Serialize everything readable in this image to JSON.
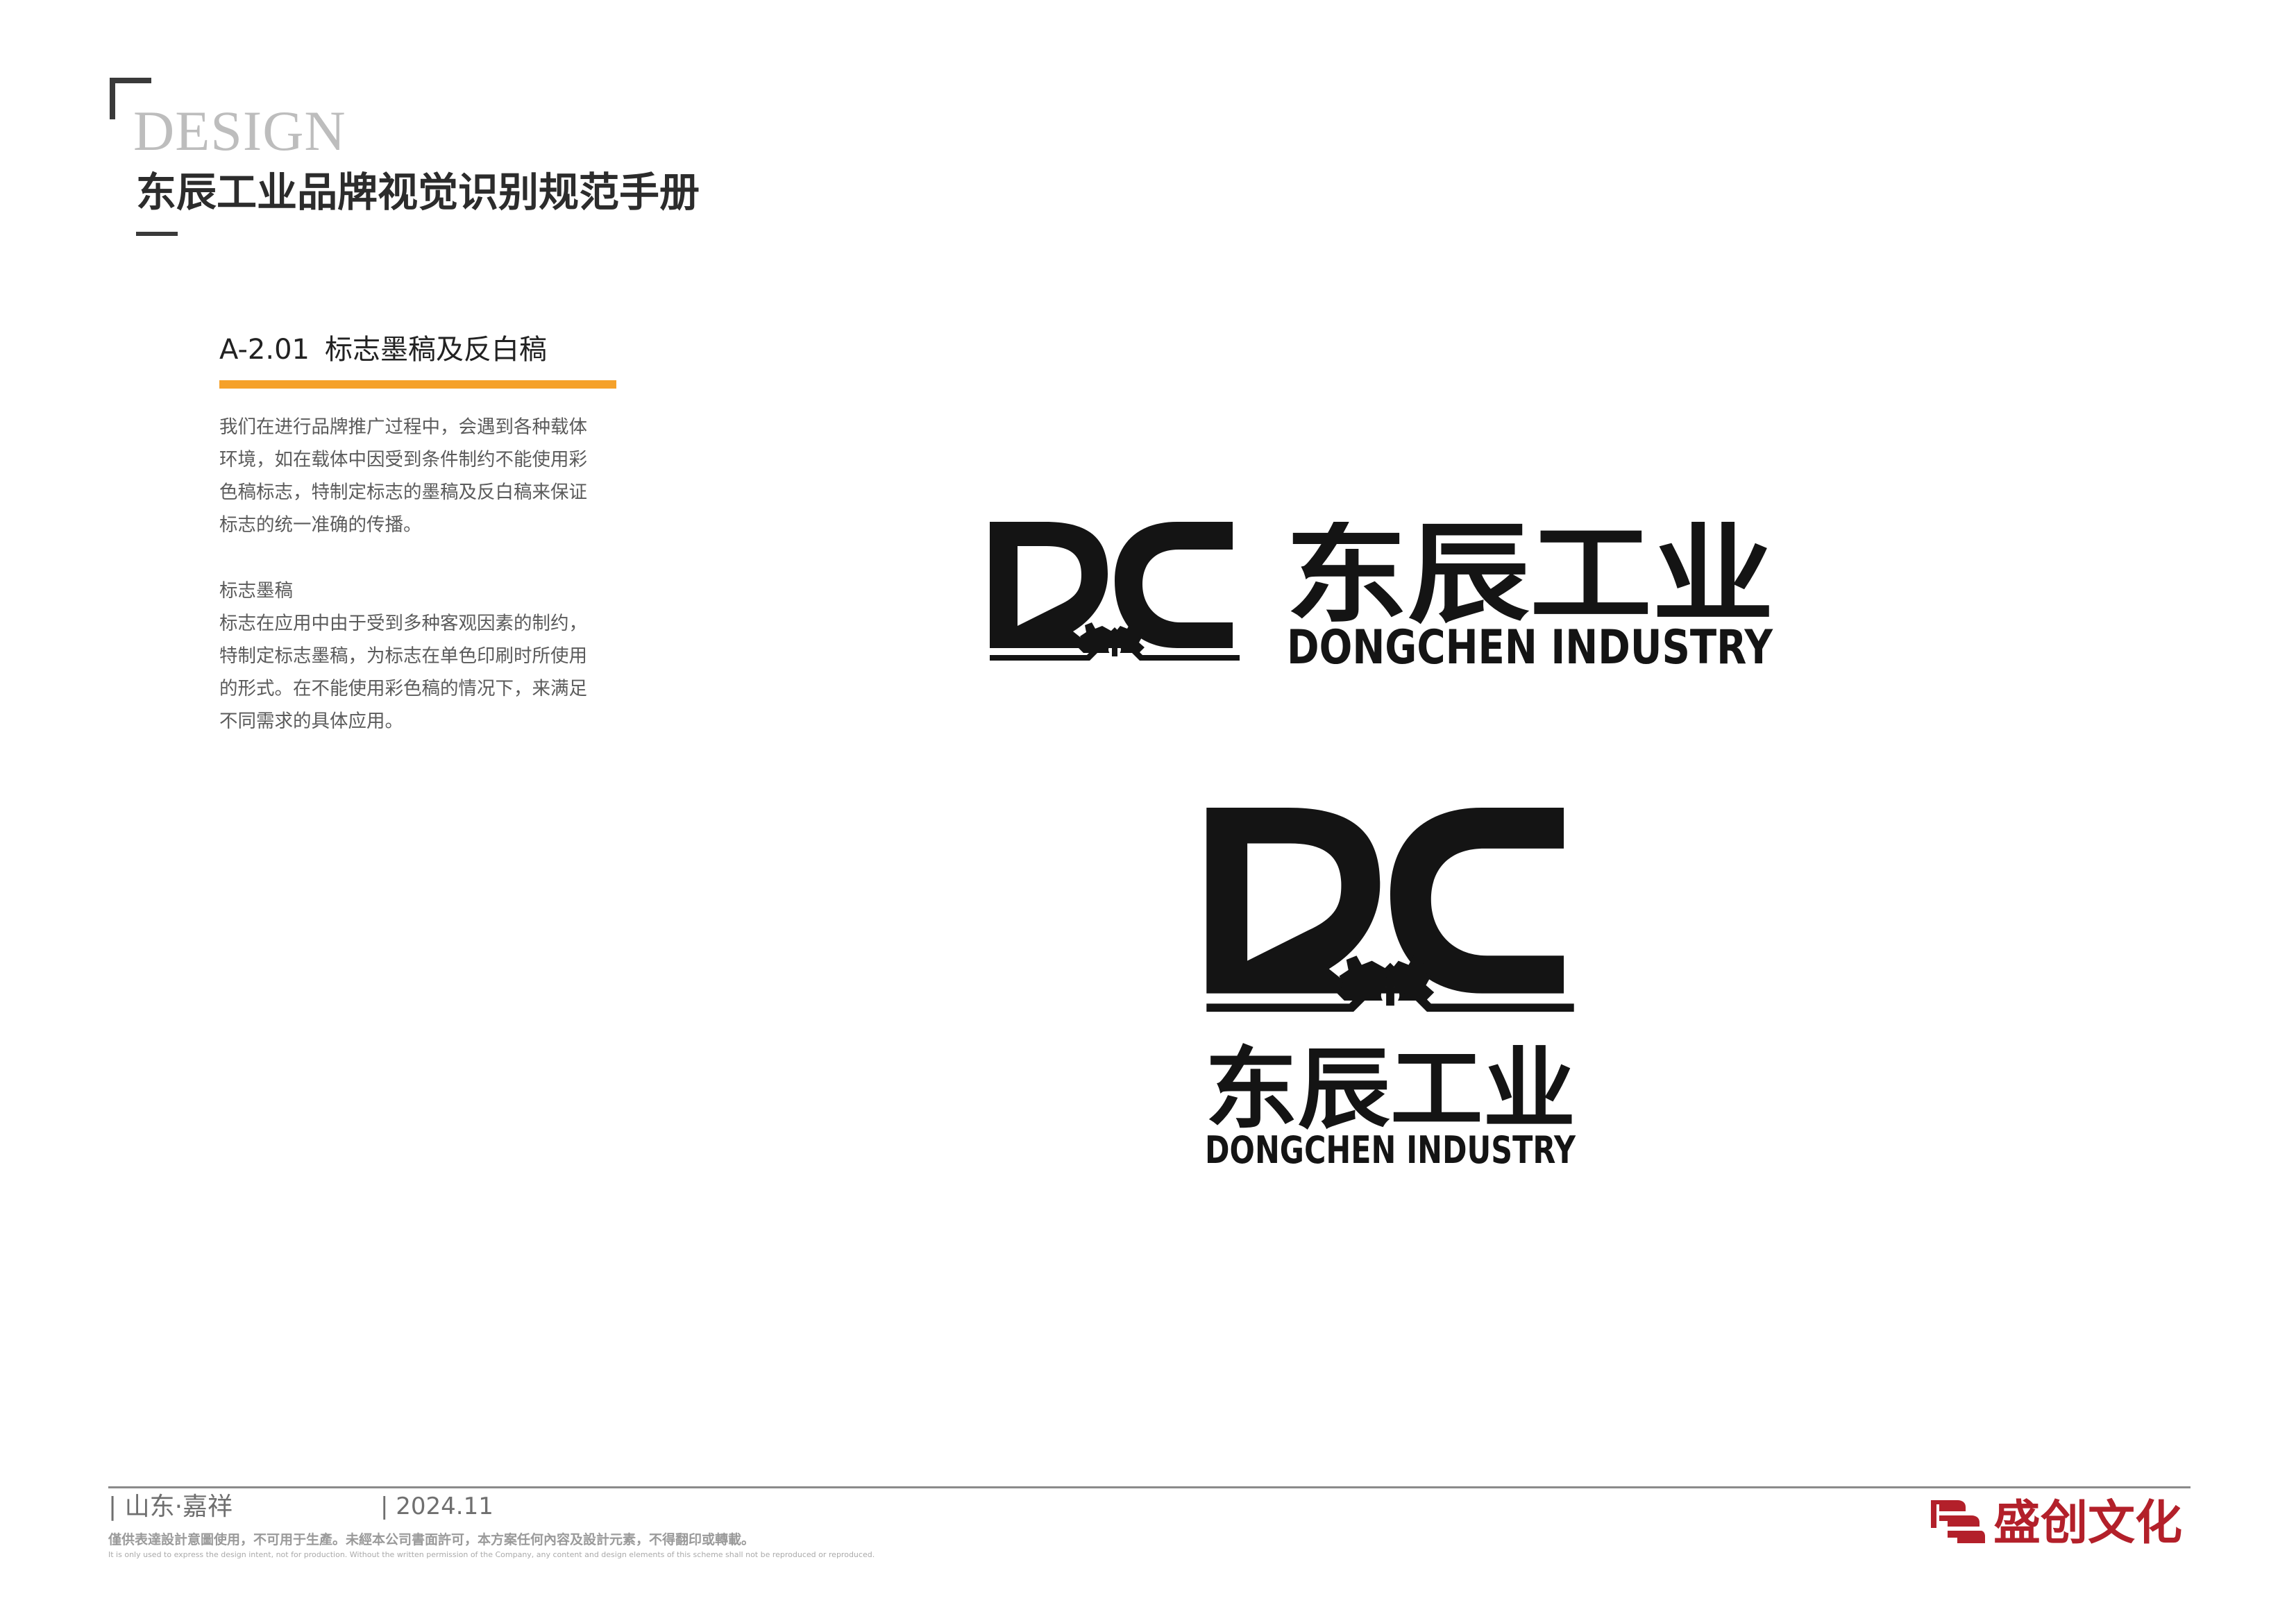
{
  "header": {
    "design_word": "DESIGN",
    "manual_title": "东辰工业品牌视觉识别规范手册"
  },
  "section": {
    "code": "A-2.01",
    "title": "标志墨稿及反白稿",
    "accent_color": "#f5a12a",
    "para1_lines": [
      "我们在进行品牌推广过程中，会遇到各种载体",
      "环境，如在载体中因受到条件制约不能使用彩",
      "色稿标志，特制定标志的墨稿及反白稿来保证",
      "标志的统一准确的传播。"
    ],
    "subheading": "标志墨稿",
    "para2_lines": [
      "标志在应用中由于受到多种客观因素的制约，",
      "特制定标志墨稿，为标志在单色印刷时所使用",
      "的形式。在不能使用彩色稿的情况下，来满足",
      "不同需求的具体应用。"
    ]
  },
  "logos": {
    "mark_letters": "DC",
    "name_cn": "东辰工业",
    "name_en": "DONGCHEN INDUSTRY",
    "ink_color": "#141414",
    "icon": "dc-gear-roof-icon"
  },
  "footer": {
    "location": "| 山东·嘉祥",
    "date": "| 2024.11",
    "notice_cn": "僅供表達設計意圖使用，不可用于生產。未經本公司書面許可，本方案任何內容及設計元素，不得翻印或轉載。",
    "notice_en": "It is only used to express the design intent, not for production. Without the written permission of the Company, any content and design elements of this scheme shall not be reproduced or reproduced.",
    "brand_name": "盛创文化",
    "brand_color": "#b3202a",
    "brand_icon": "flag-stripes-icon"
  }
}
